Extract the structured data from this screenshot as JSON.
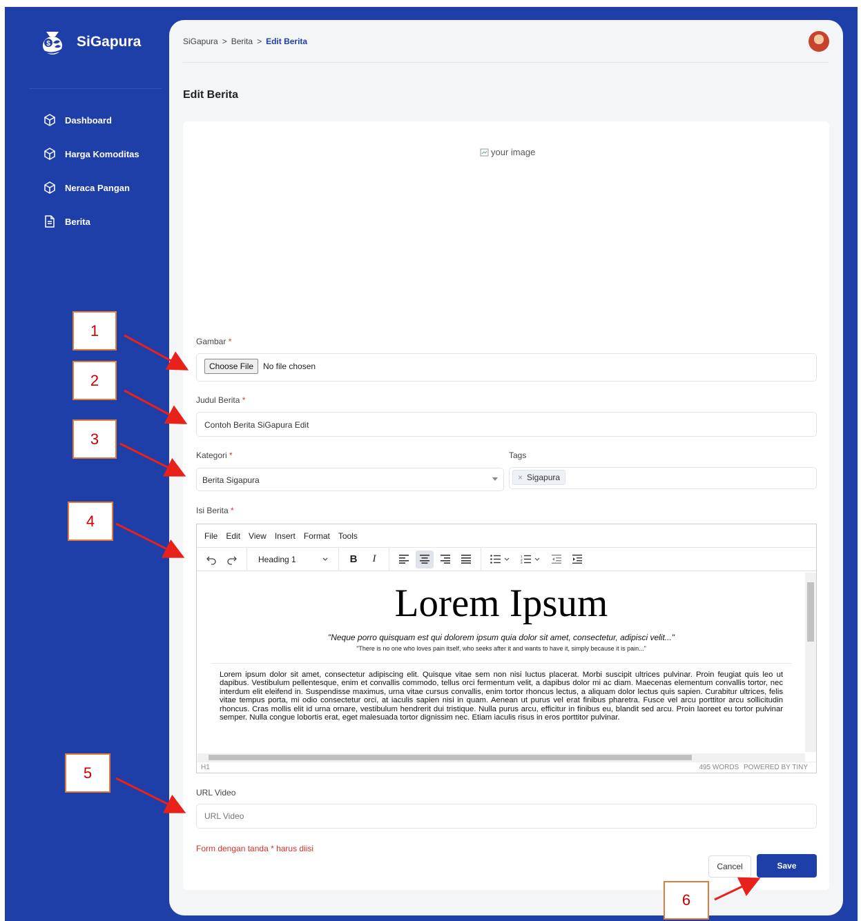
{
  "brand": {
    "name": "SiGapura"
  },
  "sidebar": {
    "items": [
      {
        "label": "Dashboard",
        "icon": "cube-icon"
      },
      {
        "label": "Harga Komoditas",
        "icon": "cube-icon"
      },
      {
        "label": "Neraca Pangan",
        "icon": "cube-icon"
      },
      {
        "label": "Berita",
        "icon": "document-icon"
      }
    ]
  },
  "breadcrumb": {
    "items": [
      "SiGapura",
      "Berita",
      "Edit Berita"
    ],
    "separator": ">"
  },
  "page": {
    "title": "Edit Berita"
  },
  "image_preview": {
    "alt": "your image"
  },
  "form": {
    "gambar": {
      "label": "Gambar",
      "required": "*",
      "button": "Choose File",
      "status": "No file chosen"
    },
    "judul": {
      "label": "Judul Berita",
      "required": "*",
      "value": "Contoh Berita SiGapura Edit"
    },
    "kategori": {
      "label": "Kategori",
      "required": "*",
      "value": "Berita Sigapura"
    },
    "tags": {
      "label": "Tags",
      "values": [
        "Sigapura"
      ],
      "remove_glyph": "×"
    },
    "isi": {
      "label": "Isi Berita",
      "required": "*"
    },
    "url_video": {
      "label": "URL Video",
      "placeholder": "URL Video"
    },
    "hint": "Form dengan tanda * harus diisi",
    "cancel": "Cancel",
    "save": "Save"
  },
  "editor": {
    "menu": [
      "File",
      "Edit",
      "View",
      "Insert",
      "Format",
      "Tools"
    ],
    "block_format": "Heading 1",
    "content": {
      "heading": "Lorem Ipsum",
      "quote": "\"Neque porro quisquam est qui dolorem ipsum quia dolor sit amet, consectetur, adipisci velit...\"",
      "quote_sub": "\"There is no one who loves pain itself, who seeks after it and wants to have it, simply because it is pain...\"",
      "paragraph": "Lorem ipsum dolor sit amet, consectetur adipiscing elit. Quisque vitae sem non nisi luctus placerat. Morbi suscipit ultrices pulvinar. Proin feugiat quis leo ut dapibus. Vestibulum pellentesque, enim et convallis commodo, tellus orci fermentum velit, a dapibus dolor mi ac diam. Maecenas elementum convallis tortor, nec interdum elit eleifend in. Suspendisse maximus, urna vitae cursus convallis, enim tortor rhoncus lectus, a aliquam dolor lectus quis sapien. Curabitur ultrices, felis vitae tempus porta, mi odio consectetur orci, at iaculis sapien nisi in quam. Aenean ut purus vel erat finibus pharetra. Fusce vel arcu porttitor arcu sollicitudin rhoncus. Cras mollis elit id urna ornare, vestibulum hendrerit dui tristique. Nulla purus arcu, efficitur in finibus eu, blandit sed arcu. Proin laoreet eu tortor pulvinar semper. Nulla congue lobortis erat, eget malesuada tortor dignissim nec. Etiam iaculis risus in eros porttitor pulvinar."
    },
    "status_path": "H1",
    "word_count": "495 WORDS",
    "powered_by": "POWERED BY TINY"
  },
  "annotations": [
    "1",
    "2",
    "3",
    "4",
    "5",
    "6"
  ],
  "colors": {
    "brand_blue": "#1e3ea8",
    "required_red": "#d33333",
    "callout_border": "#e07b39",
    "arrow_red": "#e8221b"
  }
}
